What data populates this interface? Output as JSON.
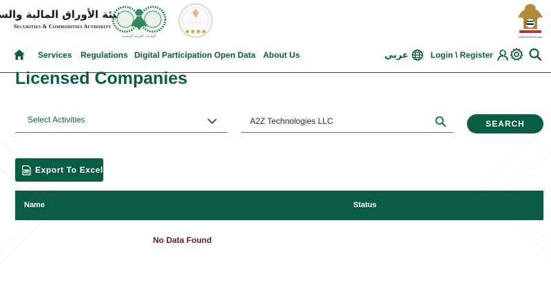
{
  "header": {
    "logo_ar": "هيئة الأوراق المالية والسلع",
    "logo_en": "Securities & Commodities Authority",
    "emblem_caption": "الإمارات العربية المتحدة",
    "uae_caption": "United Arab Emirates",
    "nav": {
      "items": [
        "Services",
        "Regulations",
        "Digital Participation",
        "Open Data",
        "About Us"
      ],
      "language": "عربي",
      "login": "Login \\ Register"
    }
  },
  "main": {
    "title": "Licensed Companies",
    "filters": {
      "activity_placeholder": "Select Activities",
      "search_value": "A2Z Technologies LLC",
      "search_button": "SEARCH"
    },
    "export_button": "Export To Excel",
    "table": {
      "columns": [
        "Name",
        "Status"
      ],
      "empty_message": "No Data Found"
    }
  },
  "colors": {
    "primary": "#0b5c45",
    "no_data": "#6b1a14",
    "gold": "#d4a82a"
  },
  "icons": [
    "home-icon",
    "globe-icon",
    "user-icon",
    "gear-icon",
    "search-icon",
    "chevron-down-icon",
    "excel-file-icon"
  ]
}
